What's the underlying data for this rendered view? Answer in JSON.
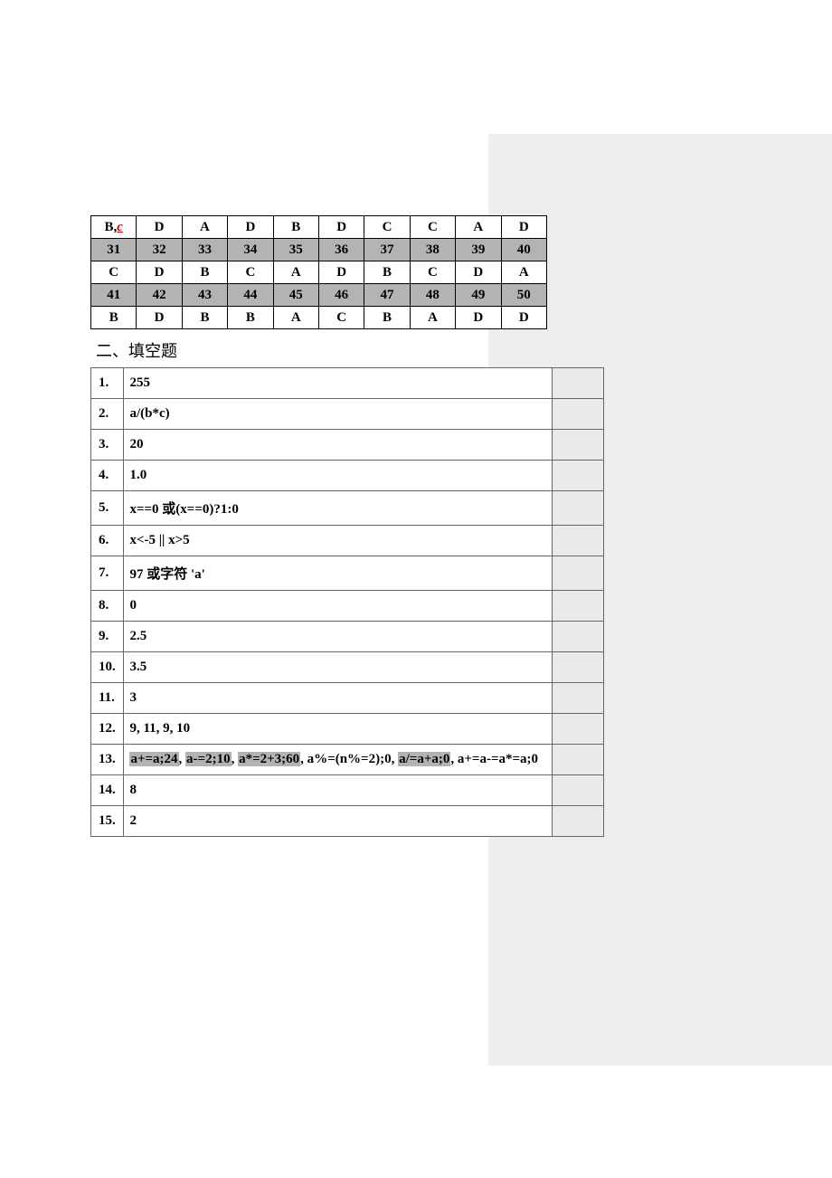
{
  "mc": {
    "row1": {
      "c1a": "B,",
      "c1b": "c",
      "c2": "D",
      "c3": "A",
      "c4": "D",
      "c5": "B",
      "c6": "D",
      "c7": "C",
      "c8": "C",
      "c9": "A",
      "c10": "D"
    },
    "nums2": [
      "31",
      "32",
      "33",
      "34",
      "35",
      "36",
      "37",
      "38",
      "39",
      "40"
    ],
    "row2": [
      "C",
      "D",
      "B",
      "C",
      "A",
      "D",
      "B",
      "C",
      "D",
      "A"
    ],
    "nums3": [
      "41",
      "42",
      "43",
      "44",
      "45",
      "46",
      "47",
      "48",
      "49",
      "50"
    ],
    "row3": [
      "B",
      "D",
      "B",
      "B",
      "A",
      "C",
      "B",
      "A",
      "D",
      "D"
    ]
  },
  "section2_title": "二、填空题",
  "fi": [
    {
      "n": "1.",
      "a": "255"
    },
    {
      "n": "2.",
      "a": "a/(b*c)"
    },
    {
      "n": "3.",
      "a": "20"
    },
    {
      "n": "4.",
      "a": "1.0"
    },
    {
      "n": "5.",
      "a": "x==0 或(x==0)?1:0"
    },
    {
      "n": "6.",
      "a": "x<-5 || x>5"
    },
    {
      "n": "7.",
      "a": "97 或字符  'a'"
    },
    {
      "n": "8.",
      "a": "0"
    },
    {
      "n": "9.",
      "a": "2.5"
    },
    {
      "n": "10.",
      "a": "3.5"
    },
    {
      "n": "11.",
      "a": "3"
    },
    {
      "n": "12.",
      "a": "9, 11, 9, 10"
    },
    {
      "n": "13.",
      "parts": {
        "p1": "a+=a;24",
        "sep1": ", ",
        "p2": "a-=2;10",
        "sep2": ", ",
        "p3": "a*=2+3;60",
        "sep3": ", ",
        "p4": "a%=(n%=2);0",
        "sep4": ", ",
        "p5": "a/=a+a;0",
        "sep5": ", ",
        "p6": "a+=a-=a*=a;0"
      }
    },
    {
      "n": "14.",
      "a": "8"
    },
    {
      "n": "15.",
      "a": "2"
    }
  ]
}
